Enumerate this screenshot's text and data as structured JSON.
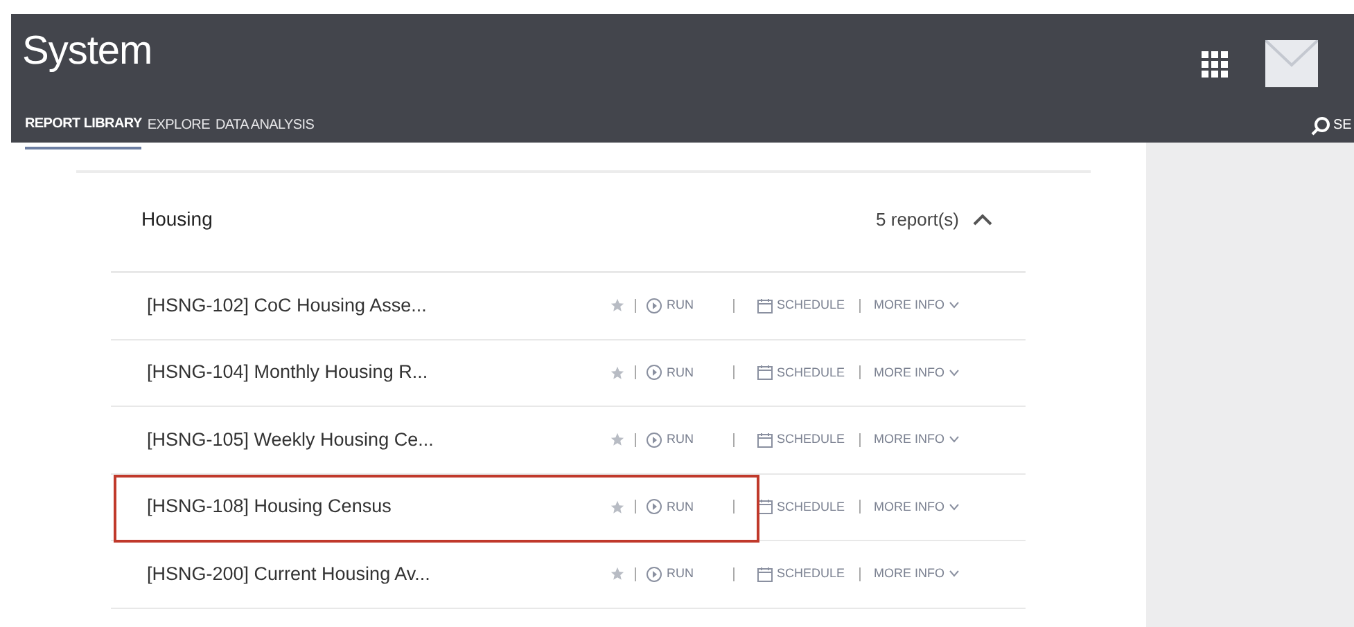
{
  "app": {
    "title": "System",
    "search_label": "SE"
  },
  "tabs": [
    {
      "label": "REPORT LIBRARY",
      "selected": true
    },
    {
      "label": "EXPLORE",
      "selected": false
    },
    {
      "label": "DATA ANALYSIS",
      "selected": false
    }
  ],
  "section": {
    "title": "Housing",
    "count": "5 report(s)",
    "expanded": true
  },
  "reports": [
    {
      "name": "[HSNG-102] CoC Housing Asse...",
      "highlighted": false,
      "run": "RUN",
      "schedule": "SCHEDULE",
      "more": "MORE INFO"
    },
    {
      "name": "[HSNG-104] Monthly Housing R...",
      "highlighted": false,
      "run": "RUN",
      "schedule": "SCHEDULE",
      "more": "MORE INFO"
    },
    {
      "name": "[HSNG-105] Weekly Housing Ce...",
      "highlighted": false,
      "run": "RUN",
      "schedule": "SCHEDULE",
      "more": "MORE INFO"
    },
    {
      "name": "[HSNG-108] Housing Census",
      "highlighted": true,
      "run": "RUN",
      "schedule": "SCHEDULE",
      "more": "MORE INFO"
    },
    {
      "name": "[HSNG-200] Current Housing Av...",
      "highlighted": false,
      "run": "RUN",
      "schedule": "SCHEDULE",
      "more": "MORE INFO"
    }
  ]
}
